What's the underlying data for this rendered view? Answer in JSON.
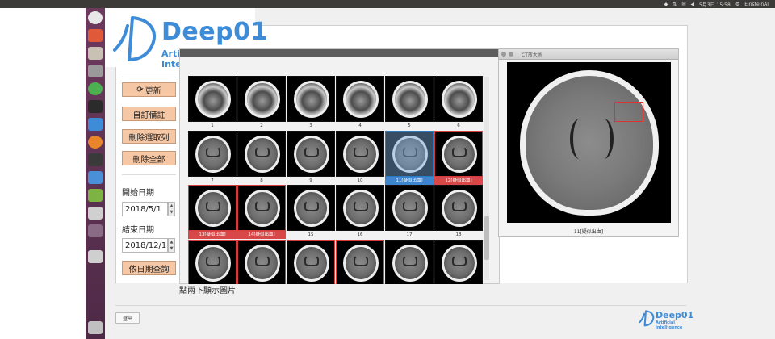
{
  "system_tray": {
    "date_time": "5月3日 15:58",
    "user": "EinsteinAI"
  },
  "logo": {
    "word": "Deep01",
    "subtitle": "Artificial Intelligence"
  },
  "sidebar": {
    "refresh_label": "更新",
    "custom_note_label": "自訂備註",
    "delete_selected_label": "刪除選取列",
    "delete_all_label": "刪除全部",
    "start_date_label": "開始日期",
    "start_date_value": "2018/5/1",
    "end_date_label": "結束日期",
    "end_date_value": "2018/12/1",
    "query_by_date_label": "依日期查詢"
  },
  "thumbnails": {
    "hint": "點兩下顯示圖片",
    "items": [
      {
        "label": "1",
        "state": "normal",
        "kind": "upper"
      },
      {
        "label": "2",
        "state": "normal",
        "kind": "upper"
      },
      {
        "label": "3",
        "state": "normal",
        "kind": "upper"
      },
      {
        "label": "4",
        "state": "normal",
        "kind": "upper"
      },
      {
        "label": "5",
        "state": "normal",
        "kind": "upper"
      },
      {
        "label": "6",
        "state": "normal",
        "kind": "upper"
      },
      {
        "label": "7",
        "state": "normal",
        "kind": "mid"
      },
      {
        "label": "8",
        "state": "normal",
        "kind": "mid"
      },
      {
        "label": "9",
        "state": "normal",
        "kind": "mid"
      },
      {
        "label": "10",
        "state": "normal",
        "kind": "mid"
      },
      {
        "label": "11[疑似出血]",
        "state": "selected",
        "kind": "mid"
      },
      {
        "label": "12[疑似出血]",
        "state": "flag",
        "kind": "mid"
      },
      {
        "label": "13[疑似出血]",
        "state": "flag",
        "kind": "mid"
      },
      {
        "label": "14[疑似出血]",
        "state": "flag",
        "kind": "mid"
      },
      {
        "label": "15",
        "state": "normal",
        "kind": "mid"
      },
      {
        "label": "16",
        "state": "normal",
        "kind": "mid"
      },
      {
        "label": "17",
        "state": "normal",
        "kind": "mid"
      },
      {
        "label": "18",
        "state": "normal",
        "kind": "mid"
      },
      {
        "label": "",
        "state": "flag",
        "kind": "mid"
      },
      {
        "label": "",
        "state": "flag",
        "kind": "mid"
      },
      {
        "label": "",
        "state": "flag",
        "kind": "mid"
      },
      {
        "label": "",
        "state": "flag",
        "kind": "mid"
      },
      {
        "label": "",
        "state": "normal",
        "kind": "mid"
      },
      {
        "label": "",
        "state": "normal",
        "kind": "mid"
      }
    ]
  },
  "zoom_window": {
    "title": "CT放大圖",
    "caption": "11[疑似出血]"
  },
  "footer": {
    "logout_label": "登出",
    "logo_word": "Deep01",
    "logo_subtitle": "Artificial Intelligence"
  },
  "colors": {
    "accent_button": "#f6c7a4",
    "flag_red": "#d94848",
    "select_blue": "#3d86cf",
    "brand_blue": "#3e8cd8",
    "launcher": "#5b2f50"
  }
}
